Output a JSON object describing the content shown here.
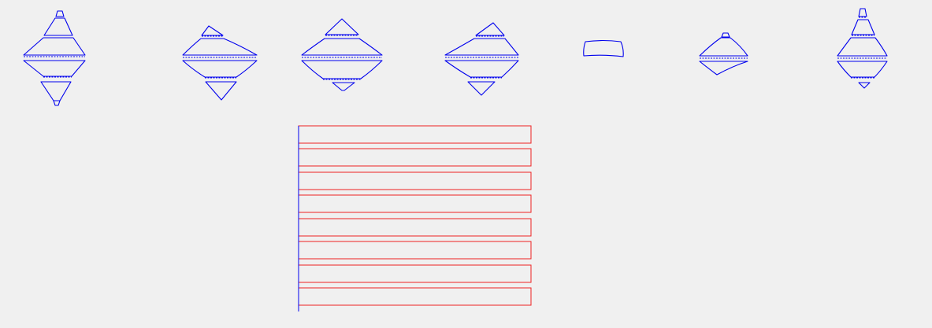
{
  "colors": {
    "background": "#f0f0f0",
    "profile_stroke": "#0000ee",
    "panel_stroke": "#ee2222",
    "axis_stroke": "#0000ee"
  },
  "profiles": {
    "count": 7,
    "shape": "lathe-profile-outline"
  },
  "panels": {
    "count": 8,
    "shape": "rectangle-outline"
  }
}
